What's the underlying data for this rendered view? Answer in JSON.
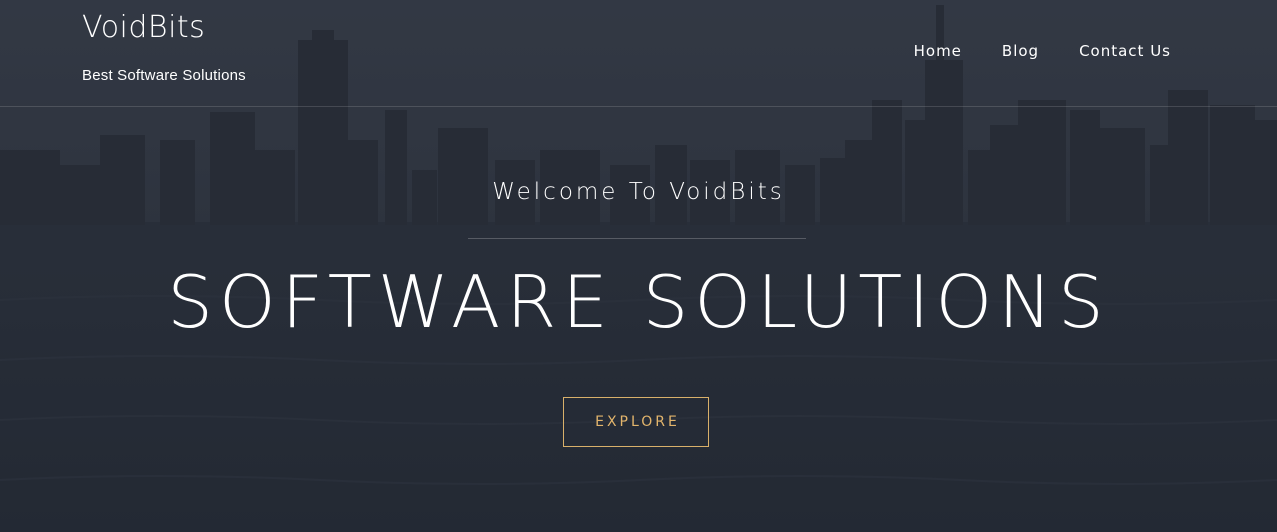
{
  "header": {
    "site_title": "VoidBits",
    "tagline": "Best Software Solutions",
    "nav": [
      {
        "label": "Home"
      },
      {
        "label": "Blog"
      },
      {
        "label": "Contact Us"
      }
    ]
  },
  "hero": {
    "welcome": "Welcome To VoidBits",
    "headline": "SOFTWARE SOLUTIONS",
    "cta_label": "EXPLORE"
  },
  "colors": {
    "overlay": "#2f3641",
    "text": "#ffffff",
    "accent": "#e3b56c"
  },
  "background": {
    "image": "city-skyline-over-water"
  }
}
